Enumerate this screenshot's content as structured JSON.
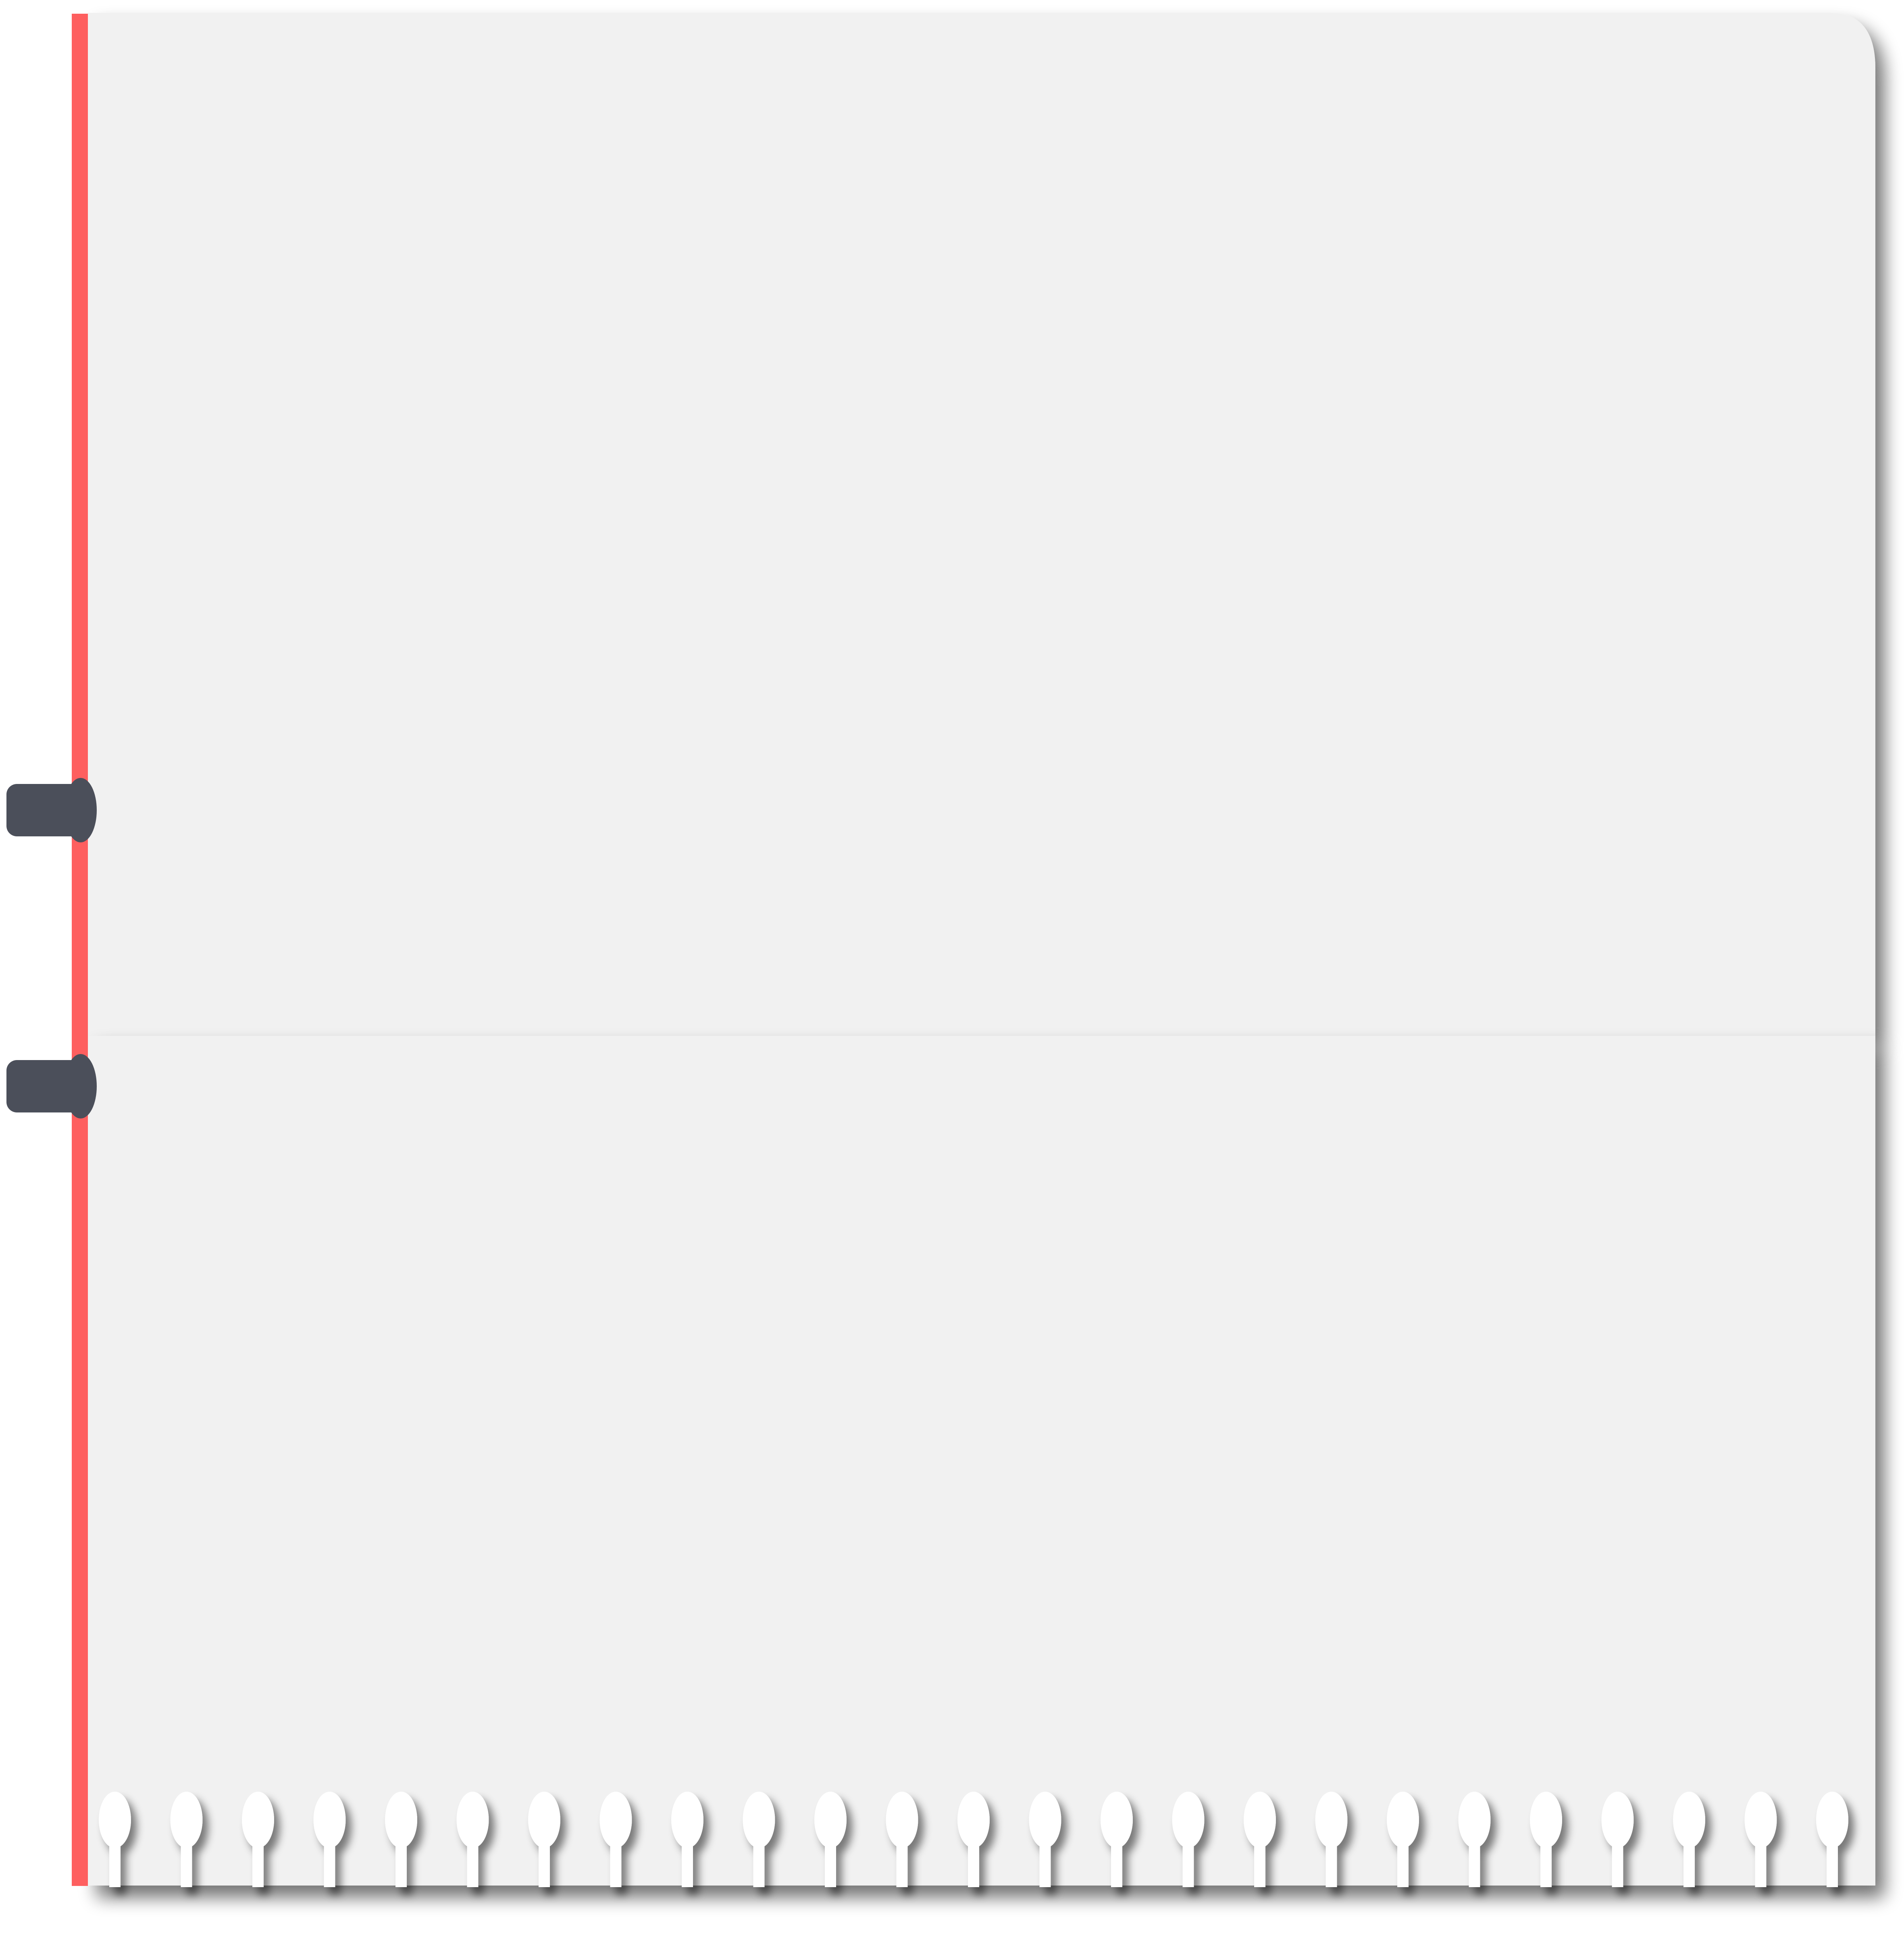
{
  "colors": {
    "background": "#ffffff",
    "paper": "#f1f1f1",
    "margin_line": "#fe5f5f",
    "clip": "#4b4f5a",
    "hole_shadow": "#8a8a8a",
    "page_shadow": "#6f6f6f"
  },
  "notepad": {
    "upper_sheet": {
      "text": ""
    },
    "lower_sheet": {
      "text": ""
    },
    "ring_holes_count": 25,
    "clips": [
      "clip-icon",
      "clip-icon"
    ]
  }
}
